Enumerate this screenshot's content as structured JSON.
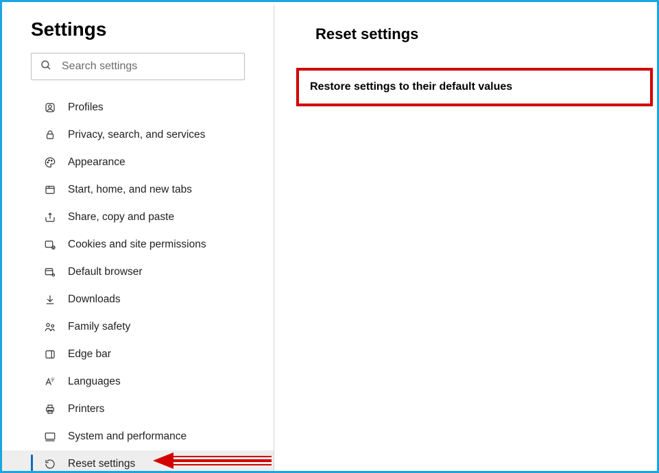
{
  "sidebar": {
    "title": "Settings",
    "search_placeholder": "Search settings",
    "items": [
      {
        "label": "Profiles"
      },
      {
        "label": "Privacy, search, and services"
      },
      {
        "label": "Appearance"
      },
      {
        "label": "Start, home, and new tabs"
      },
      {
        "label": "Share, copy and paste"
      },
      {
        "label": "Cookies and site permissions"
      },
      {
        "label": "Default browser"
      },
      {
        "label": "Downloads"
      },
      {
        "label": "Family safety"
      },
      {
        "label": "Edge bar"
      },
      {
        "label": "Languages"
      },
      {
        "label": "Printers"
      },
      {
        "label": "System and performance"
      },
      {
        "label": "Reset settings"
      }
    ]
  },
  "main": {
    "title": "Reset settings",
    "restore_label": "Restore settings to their default values"
  },
  "annotation": {
    "highlight_color": "#d40000",
    "arrow_color": "#d40000"
  }
}
